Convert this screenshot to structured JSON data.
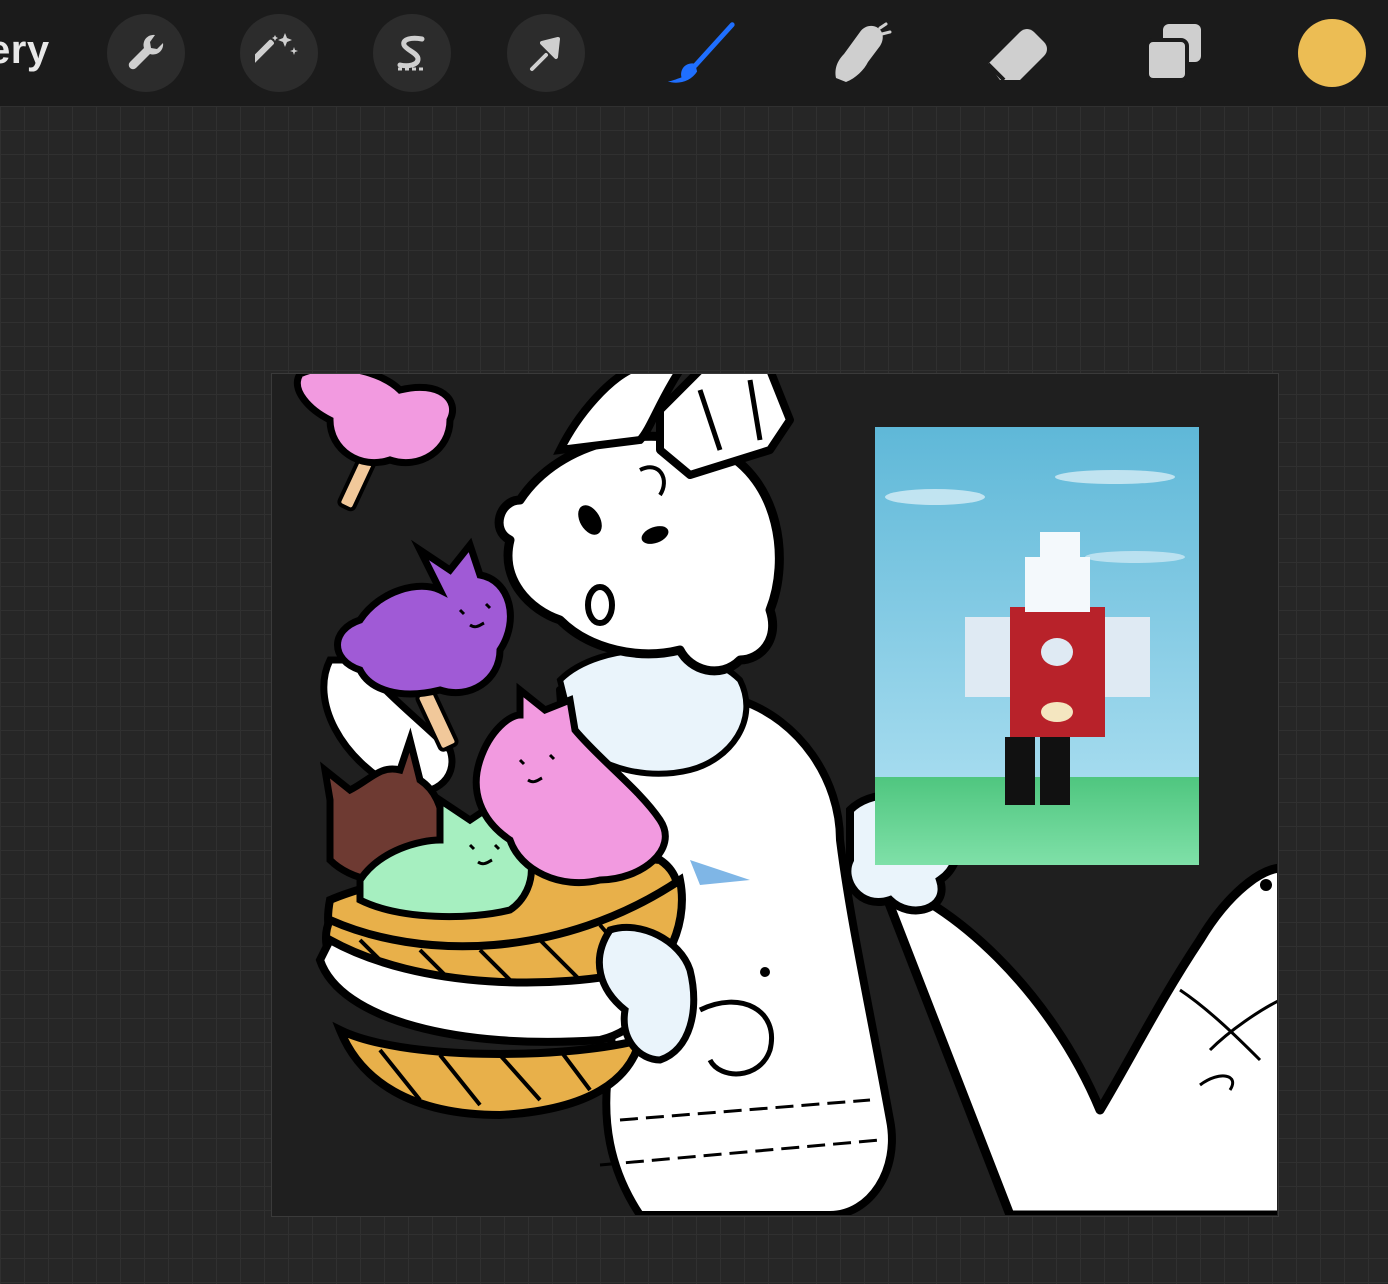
{
  "toolbar": {
    "gallery_label": "ery",
    "tools": [
      {
        "name": "actions",
        "icon": "wrench-icon"
      },
      {
        "name": "adjustments",
        "icon": "magic-wand-icon"
      },
      {
        "name": "selection",
        "icon": "selection-s-icon"
      },
      {
        "name": "transform",
        "icon": "arrow-cursor-icon"
      },
      {
        "name": "brush",
        "icon": "paintbrush-icon",
        "active": true
      },
      {
        "name": "smudge",
        "icon": "smudge-finger-icon"
      },
      {
        "name": "eraser",
        "icon": "eraser-icon"
      },
      {
        "name": "layers",
        "icon": "layers-icon"
      }
    ],
    "current_color": "#ecbd54"
  },
  "colors": {
    "toolbar_bg": "#1b1b1b",
    "active_tool": "#1f6fff",
    "inactive_tool": "#cfcfcf",
    "pink_cat": "#f29ae0",
    "purple_cat": "#a05ad6",
    "mint_cat": "#a6efc0",
    "brown_cat": "#6e3a32",
    "basket": "#e8b04a",
    "sky": "#5fb8d8",
    "grass": "#5fcf8c",
    "shirt_red": "#b8222a"
  }
}
